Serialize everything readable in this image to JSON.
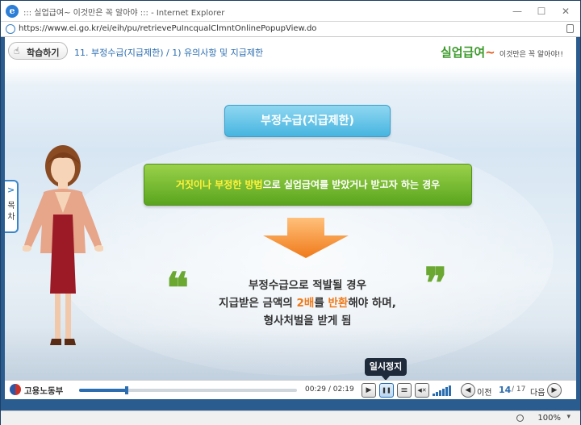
{
  "window": {
    "title": "::: 실업급여~ 이것만은 꼭 알아야 ::: - Internet Explorer",
    "minimize": "—",
    "maximize": "☐",
    "close": "✕"
  },
  "address": {
    "url": "https://www.ei.go.kr/ei/eih/pu/retrievePuIncqualClmntOnlinePopupView.do"
  },
  "header": {
    "learn_button": "학습하기",
    "learn_icon": "hand-pointer-icon",
    "breadcrumb": "11. 부정수급(지급제한) / 1) 유의사항 및 지급제한",
    "brand_main": "실업급여",
    "brand_tilde": "~",
    "brand_sub": "이것만은 꼭 알아야!!"
  },
  "side_tab": {
    "chevron": ">",
    "label_line1": "목",
    "label_line2": "차"
  },
  "slide": {
    "title": "부정수급(지급제한)",
    "condition_hl1": "거짓이나",
    "condition_mid": " ",
    "condition_hl2": "부정한 방법",
    "condition_rest": "으로 실업급여를 받았거나 받고자 하는 경우",
    "quote_open": "❝",
    "quote_close": "❞",
    "line1": "부정수급으로 적발될 경우",
    "line2_pre": "지급받은 금액의 ",
    "line2_hl1": "2배",
    "line2_mid": "를 ",
    "line2_hl2": "반환",
    "line2_post": "해야 하며,",
    "line3": "형사처벌을 받게 됨"
  },
  "controls": {
    "ministry": "고용노동부",
    "progress_fraction": 0.22,
    "current_time": "00:29",
    "separator": "/",
    "total_time": "02:19",
    "play_icon": "▶",
    "pause_icon": "❚❚",
    "menu_icon": "≡",
    "mute_icon": "◀✕",
    "prev_icon": "◀",
    "prev_label": "이전",
    "page_current": "14",
    "page_total": "/ 17",
    "next_label": "다음",
    "next_icon": "▶",
    "tooltip": "일시정지"
  },
  "status": {
    "zoom": "100%",
    "dropdown": "▾"
  },
  "colors": {
    "accent_blue": "#2a6db0",
    "highlight_orange": "#f07a1a",
    "highlight_yellow": "#fff23a",
    "green": "#5aa51e"
  }
}
